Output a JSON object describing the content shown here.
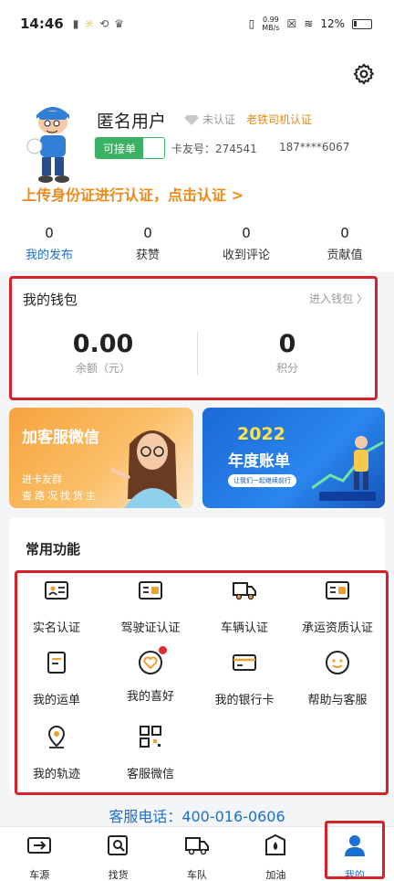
{
  "status_bar": {
    "time": "14:46",
    "net_speed_value": "0.99",
    "net_speed_unit": "MB/s",
    "battery": "12%"
  },
  "profile": {
    "username": "匿名用户",
    "verify_status": "未认证",
    "driver_cert": "老铁司机认证",
    "accept_order": "可接单",
    "card_no": "卡友号：274541",
    "phone": "187****6067",
    "upload_cta": "上传身份证进行认证，点击认证 >"
  },
  "stats": [
    {
      "value": "0",
      "label": "我的发布"
    },
    {
      "value": "0",
      "label": "获赞"
    },
    {
      "value": "0",
      "label": "收到评论"
    },
    {
      "value": "0",
      "label": "贡献值"
    }
  ],
  "wallet": {
    "title": "我的钱包",
    "enter": "进入钱包 〉",
    "balance_value": "0.00",
    "balance_label": "余额（元）",
    "points_value": "0",
    "points_label": "积分"
  },
  "banners": {
    "left_title": "加客服微信",
    "left_sub1": "进卡友群",
    "left_sub2": "查路况找货主",
    "right_year": "2022",
    "right_title": "年度账单",
    "right_sub": "让我们一起继续前行"
  },
  "functions": {
    "heading": "常用功能",
    "items": [
      {
        "label": "实名认证",
        "icon": "id-card-icon"
      },
      {
        "label": "驾驶证认证",
        "icon": "license-icon"
      },
      {
        "label": "车辆认证",
        "icon": "truck-icon"
      },
      {
        "label": "承运资质认证",
        "icon": "qualification-icon"
      },
      {
        "label": "我的运单",
        "icon": "waybill-icon"
      },
      {
        "label": "我的喜好",
        "icon": "heart-icon"
      },
      {
        "label": "我的银行卡",
        "icon": "bank-card-icon"
      },
      {
        "label": "帮助与客服",
        "icon": "smile-icon"
      },
      {
        "label": "我的轨迹",
        "icon": "location-pin-icon"
      },
      {
        "label": "客服微信",
        "icon": "qr-code-icon"
      }
    ]
  },
  "service_tel": "客服电话：400-016-0606",
  "tabs": [
    {
      "label": "车源",
      "icon": "truck-source-icon"
    },
    {
      "label": "找货",
      "icon": "search-cargo-icon"
    },
    {
      "label": "车队",
      "icon": "fleet-icon"
    },
    {
      "label": "加油",
      "icon": "fuel-icon"
    },
    {
      "label": "我的",
      "icon": "user-icon"
    }
  ],
  "colors": {
    "accent": "#1a6fd0",
    "orange": "#ee8a1a",
    "green": "#3bb163",
    "highlight": "#d8222a"
  }
}
